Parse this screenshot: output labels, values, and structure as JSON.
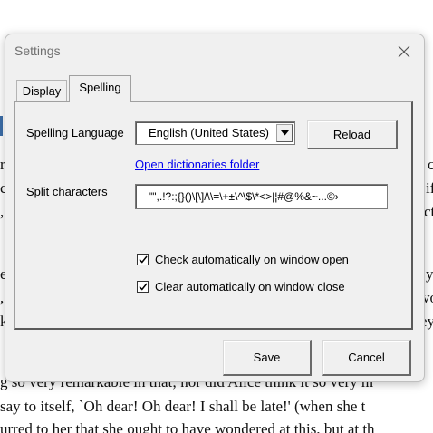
{
  "document": {
    "fragments": [
      "r",
      "c",
      "c",
      "if",
      ",",
      "ct",
      "e",
      "y",
      ",",
      "vo",
      "k",
      "ey",
      "g so very remarkable in that; nor did Alice think it so very m",
      "say to itself, `Oh dear! Oh dear! I shall be late!' (when she t",
      "urred to her that she ought to have wondered at this, but at th"
    ]
  },
  "window": {
    "title": "Settings",
    "close_icon": "close-icon"
  },
  "tabs": [
    {
      "label": "Display",
      "active": false
    },
    {
      "label": "Spelling",
      "active": true
    }
  ],
  "spelling": {
    "language_label": "Spelling Language",
    "language_value": "English (United States)",
    "reload_label": "Reload",
    "open_folder_link": "Open dictionaries folder",
    "split_label": "Split characters",
    "split_value": "\"\",.!?:;{}()\\[\\]/\\\\=\\+±\\^\\$\\*<>|¦#@%&~...©›",
    "checks": [
      {
        "label": "Check automatically on window open",
        "checked": true
      },
      {
        "label": "Clear automatically on window close",
        "checked": true
      }
    ]
  },
  "footer": {
    "save_label": "Save",
    "cancel_label": "Cancel"
  }
}
